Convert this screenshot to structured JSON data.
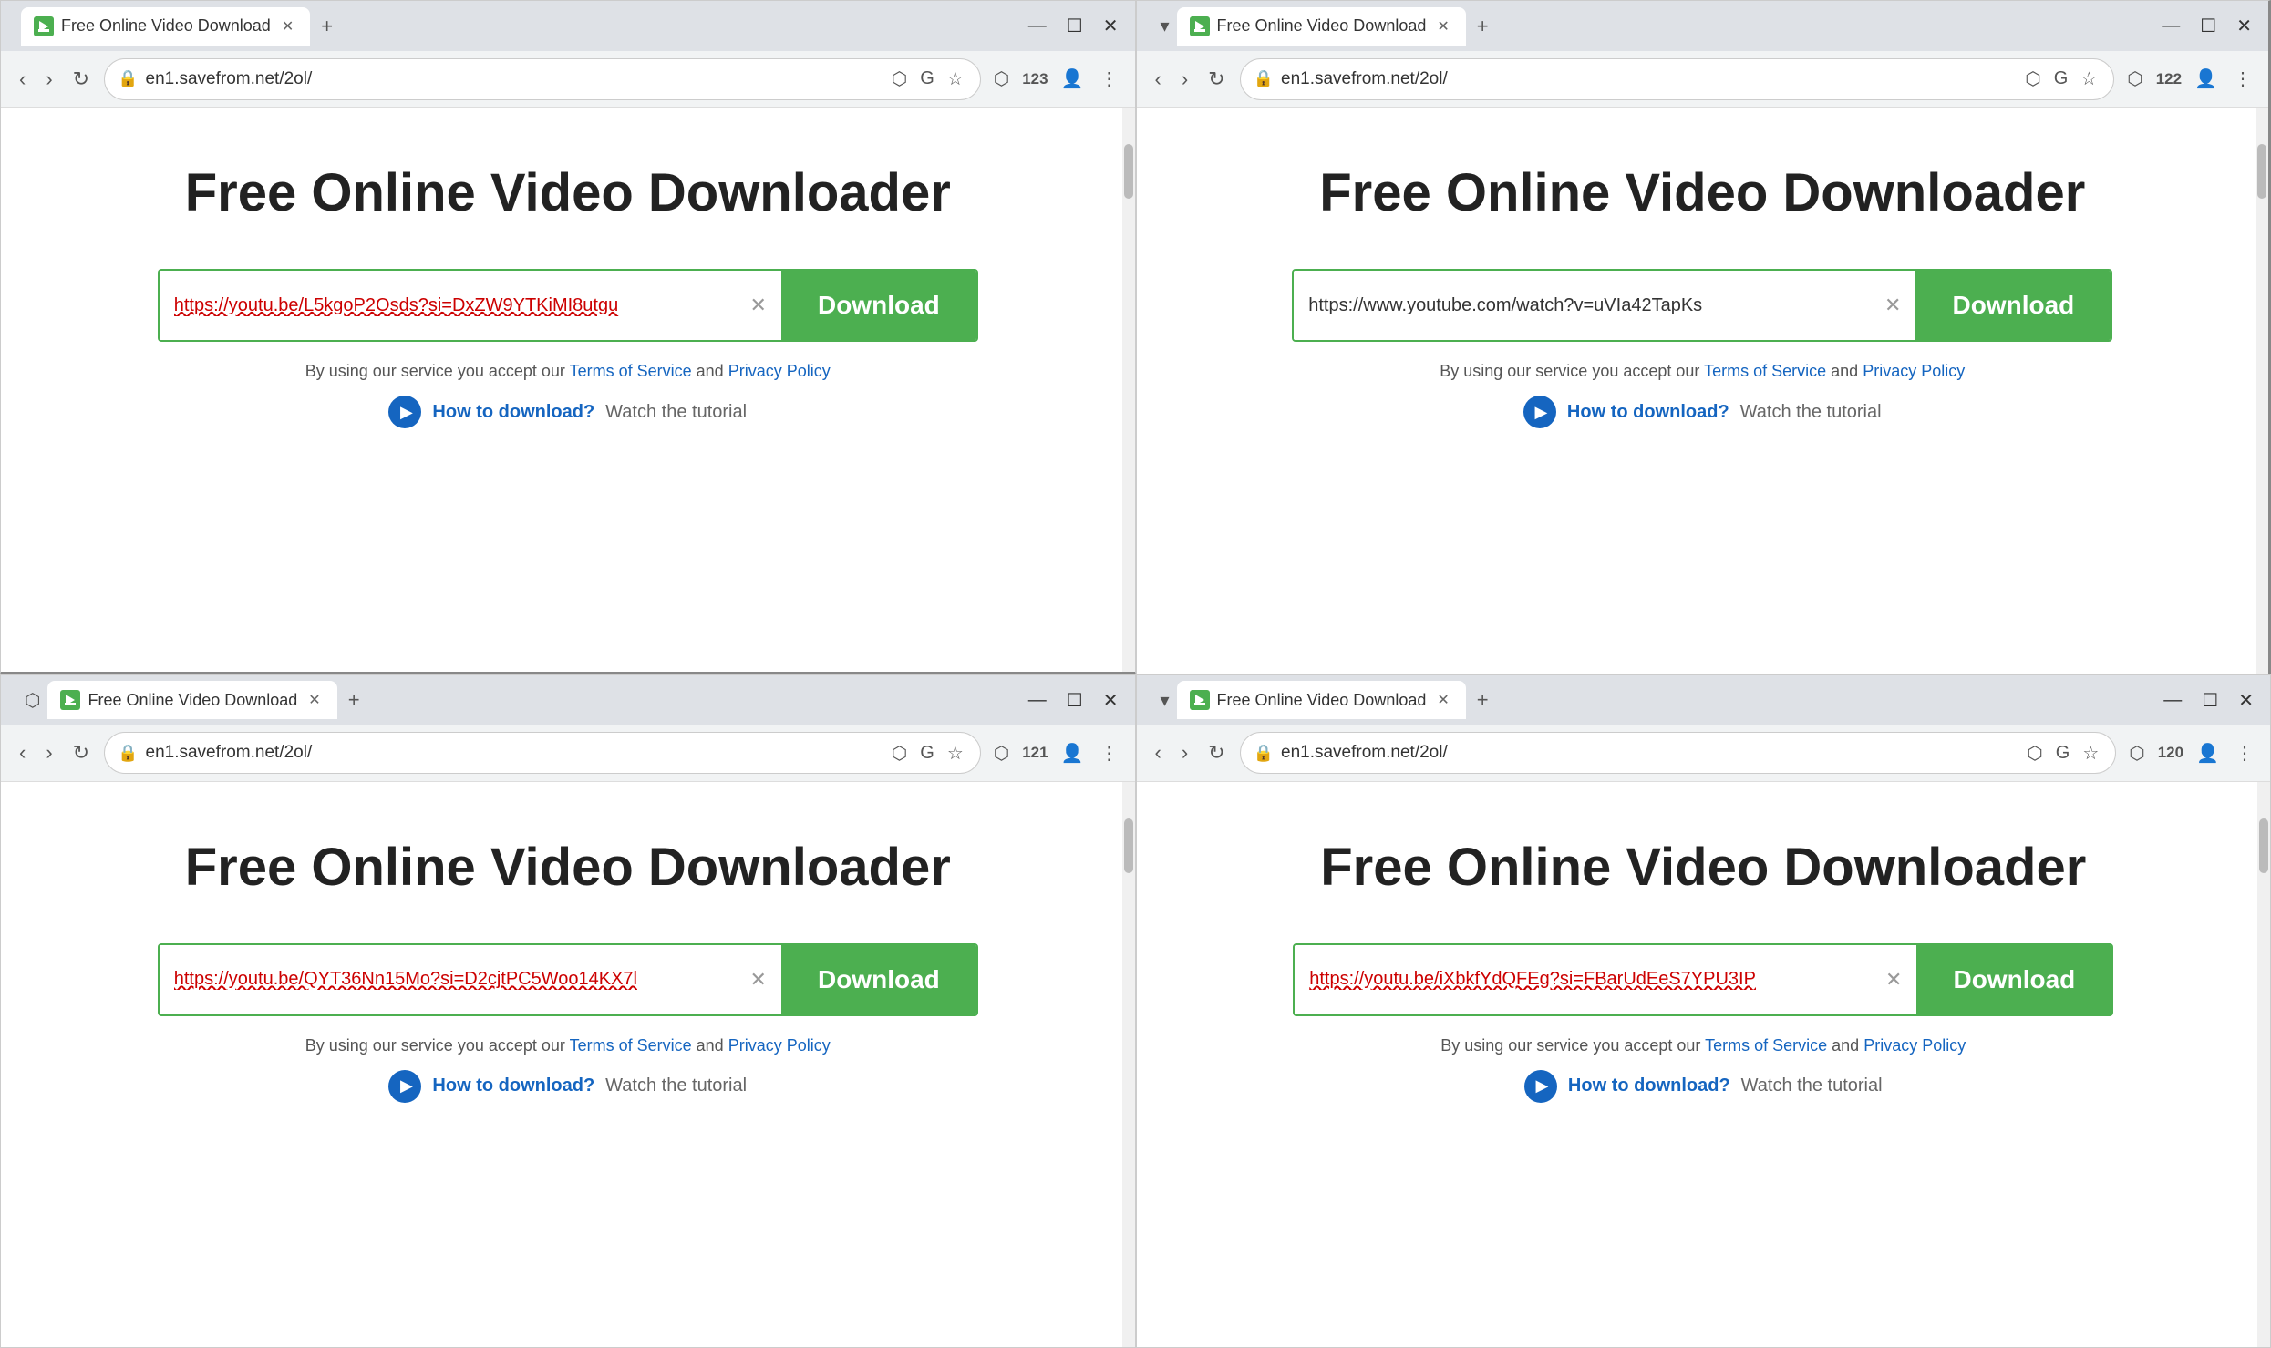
{
  "windows": [
    {
      "id": "window-1",
      "tab_title": "Free Online Video Download",
      "tab_counter": "123",
      "url": "en1.savefrom.net/2ol/",
      "page_title": "Free Online Video Downloader",
      "url_value": "https://youtu.be/L5kgoP2Osds?si=DxZW9YTKiMI8utgu",
      "url_style": "red",
      "download_btn_label": "Download",
      "terms_text_1": "By using our service you accept our",
      "terms_link_1": "Terms of Service",
      "terms_text_2": "and",
      "terms_link_2": "Privacy Policy",
      "how_to_link": "How to download?",
      "watch_text": "Watch the tutorial"
    },
    {
      "id": "window-2",
      "tab_title": "Free Online Video Download",
      "tab_counter": "122",
      "url": "en1.savefrom.net/2ol/",
      "page_title": "Free Online Video Downloader",
      "url_value": "https://www.youtube.com/watch?v=uVIa42TapKs",
      "url_style": "normal",
      "download_btn_label": "Download",
      "terms_text_1": "By using our service you accept our",
      "terms_link_1": "Terms of Service",
      "terms_text_2": "and",
      "terms_link_2": "Privacy Policy",
      "how_to_link": "How to download?",
      "watch_text": "Watch the tutorial"
    },
    {
      "id": "window-3",
      "tab_title": "Free Online Video Download",
      "tab_counter": "121",
      "url": "en1.savefrom.net/2ol/",
      "page_title": "Free Online Video Downloader",
      "url_value": "https://youtu.be/QYT36Nn15Mo?si=D2cjtPC5Woo14KX7l",
      "url_style": "red",
      "download_btn_label": "Download",
      "terms_text_1": "By using our service you accept our",
      "terms_link_1": "Terms of Service",
      "terms_text_2": "and",
      "terms_link_2": "Privacy Policy",
      "how_to_link": "How to download?",
      "watch_text": "Watch the tutorial"
    },
    {
      "id": "window-4",
      "tab_title": "Free Online Video Download",
      "tab_counter": "120",
      "url": "en1.savefrom.net/2ol/",
      "page_title": "Free Online Video Downloader",
      "url_value": "https://youtu.be/iXbkfYdQFEg?si=FBarUdEeS7YPU3IP",
      "url_style": "red",
      "download_btn_label": "Download",
      "terms_text_1": "By using our service you accept our",
      "terms_link_1": "Terms of Service",
      "terms_text_2": "and",
      "terms_link_2": "Privacy Policy",
      "how_to_link": "How to download?",
      "watch_text": "Watch the tutorial"
    }
  ],
  "buttons": {
    "back": "‹",
    "forward": "›",
    "reload": "↻",
    "minimize": "—",
    "maximize": "☐",
    "close": "✕",
    "new_tab": "+",
    "tab_close": "✕",
    "clear": "✕"
  }
}
